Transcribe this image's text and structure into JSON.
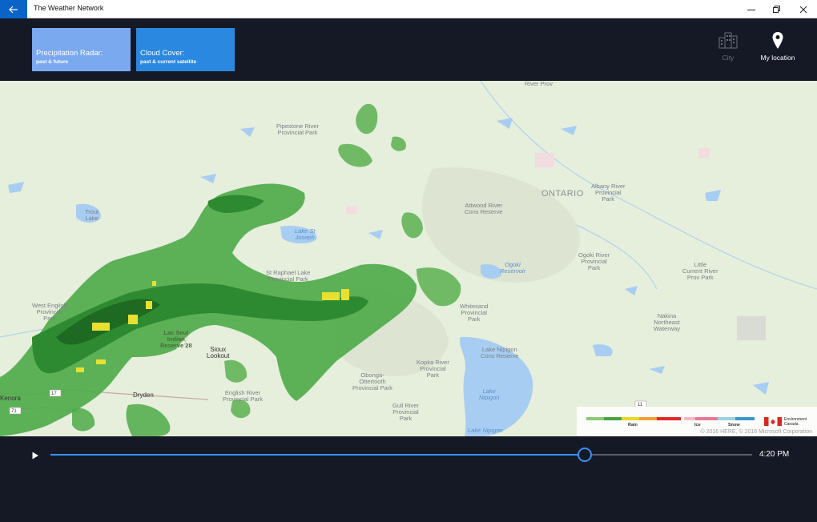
{
  "window": {
    "title": "The Weather Network"
  },
  "tiles": [
    {
      "title": "Precipitation Radar:",
      "subtitle": "past & future"
    },
    {
      "title": "Cloud Cover:",
      "subtitle": "past & current satellite"
    }
  ],
  "header_buttons": {
    "city": "City",
    "my_location": "My location"
  },
  "map": {
    "labels": {
      "river_prov": "River Prov",
      "pipestone": "Pipestone River\nProvincial Park",
      "ontario": "ONTARIO",
      "albany": "Albany River\nProvincial\nPark",
      "trout_lake": "Trout\nLake",
      "attwood": "Attwood River\nCons Reserve",
      "lake_st_joseph": "Lake St\nJoseph",
      "ogoki_res": "Ogoki\nReservoir",
      "ogoki_park": "Ogoki River\nProvincial\nPark",
      "little_current": "Little\nCurrent River\nProv Park",
      "st_raphael": "St Raphael Lake\nProvincial Park",
      "west_english": "West English\nProvincial\nPark",
      "lac_seul": "Lac Seul\nIndian\nReserve 28",
      "whitesand": "Whitesand\nProvincial\nPark",
      "nakina": "Nakina\nNortheast\nWaterway",
      "sioux_lookout": "Sioux\nLookout",
      "lake_nipigon_cons": "Lake Nipigon\nCons Reserve",
      "kopka": "Kopka River\nProvincial\nPark",
      "obonga": "Obonga-\nOttertooth\nProvincial Park",
      "dryden": "Dryden",
      "kenora": "Kenora",
      "english_river": "English River\nProvincial Park",
      "gull_river": "Gull River\nProvincial\nPark",
      "lake_nipigon": "Lake\nNipigon",
      "lake_nipigon_bottom": "Lake Nipigon",
      "hwy17": "17",
      "hwy71": "71",
      "hwy11": "11"
    },
    "copyright": "© 2016 HERE, © 2016 Microsoft Corporation"
  },
  "legend": {
    "rain": "Rain",
    "ice": "Ice",
    "snow": "Snow",
    "agency": "Environment\nCanada",
    "colors": {
      "rain": [
        "#8dc878",
        "#4aa048",
        "#e8d828",
        "#f0a030",
        "#e02828"
      ],
      "ice": [
        "#f4b8c8",
        "#e87898"
      ],
      "snow": [
        "#9ad0e0",
        "#3a98c8"
      ]
    }
  },
  "player": {
    "time": "4:20 PM",
    "progress": 0.761
  }
}
